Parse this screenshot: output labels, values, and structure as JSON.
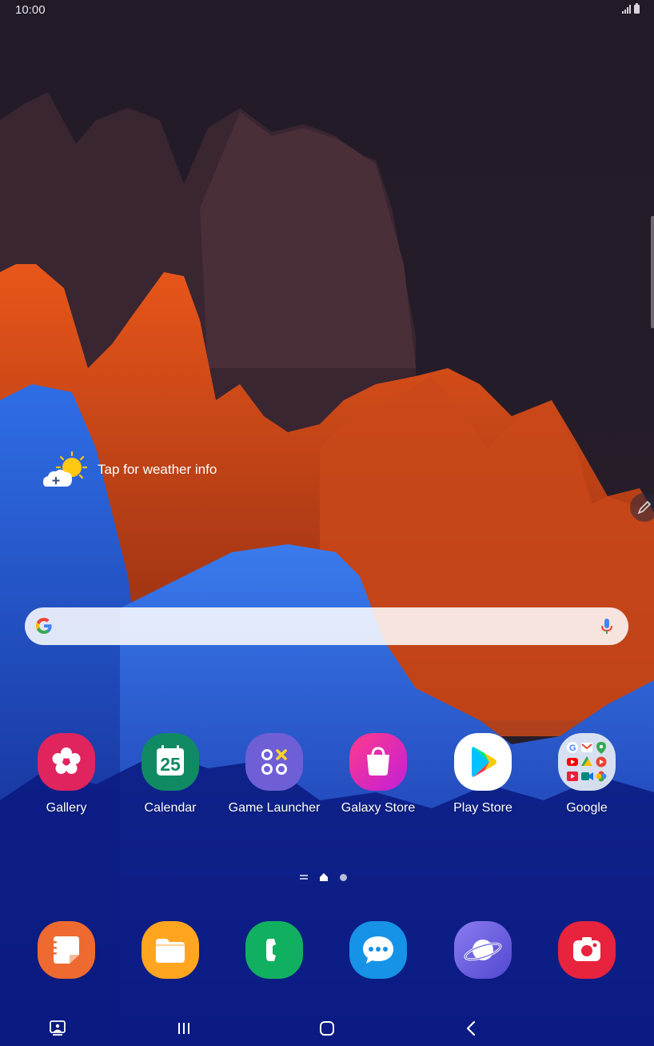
{
  "status_bar": {
    "time": "10:00",
    "signal_icon": "signal-icon",
    "battery_icon": "battery-icon"
  },
  "weather_widget": {
    "label": "Tap for weather info",
    "icon": "weather-sun-cloud-icon"
  },
  "search_bar": {
    "left_icon": "google-g-icon",
    "right_icon": "mic-icon"
  },
  "home_apps": [
    {
      "label": "Gallery",
      "icon": "gallery-flower-icon",
      "color": "#e0245e"
    },
    {
      "label": "Calendar",
      "icon": "calendar-icon",
      "day": "25",
      "color": "#108a63"
    },
    {
      "label": "Game Launcher",
      "icon": "game-launcher-icon",
      "color": "#6f5fd6"
    },
    {
      "label": "Galaxy Store",
      "icon": "shopping-bag-icon",
      "color": "#d61e8d"
    },
    {
      "label": "Play Store",
      "icon": "play-store-icon",
      "color": "#ffffff"
    },
    {
      "label": "Google",
      "icon": "google-folder-icon",
      "color": "#dfe8f3"
    }
  ],
  "page_indicator": {
    "icons": [
      "page-lines-icon",
      "home-page-icon",
      "page-dot-icon"
    ]
  },
  "dock_apps": [
    {
      "icon": "notes-icon",
      "color": "#ee6a30"
    },
    {
      "icon": "my-files-folder-icon",
      "color": "#ffa51f"
    },
    {
      "icon": "phone-icon",
      "color": "#11b060"
    },
    {
      "icon": "messages-icon",
      "color": "#1692e6"
    },
    {
      "icon": "internet-planet-icon",
      "color": "#6d63e0"
    },
    {
      "icon": "screen-recorder-icon",
      "color": "#e8233d"
    }
  ],
  "nav_bar": {
    "icons": [
      "screenshot-icon",
      "recent-apps-icon",
      "home-button-icon",
      "back-icon"
    ]
  }
}
